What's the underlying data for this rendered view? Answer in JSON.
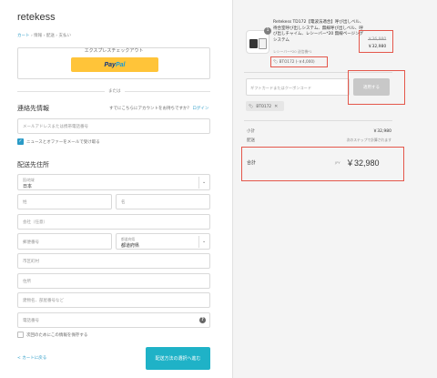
{
  "left": {
    "store_name": "retekess",
    "breadcrumbs": [
      "カート",
      "情報",
      "配送",
      "支払い"
    ],
    "express_title": "エクスプレスチェックアウト",
    "paypal_pay": "Pay",
    "paypal_pal": "Pal",
    "or_text": "または",
    "contact": {
      "heading": "連絡先情報",
      "has_account": "すでにこちらにアカウントをお持ちですか？",
      "login": "ログイン",
      "email_placeholder": "メールアドレスまたは携帯電話番号",
      "newsletter": "ニュースとオファーをメールで受け取る"
    },
    "shipping": {
      "heading": "配送先住所",
      "country_label": "国/地域",
      "country_value": "日本",
      "last_name": "姓",
      "first_name": "名",
      "company": "会社（任意）",
      "postal": "郵便番号",
      "pref_label": "都道府県",
      "pref_value": "都道府県",
      "city": "市区町村",
      "address": "住所",
      "building": "建物名、部屋番号など",
      "phone": "電話番号",
      "save_info": "次回のためにこの情報を保存する"
    },
    "back_link": "< カートに戻る",
    "continue_button": "配送方法の選択へ進む"
  },
  "right": {
    "product": {
      "quantity": "1",
      "name": "Retekess TD172【電波法適合】呼び出しベル、待合室呼び出しシステム、無線呼び出しベル、呼び出しチャイム、レシーバー*20 無線ページングシステム",
      "variant": "レシーバー*20 送信機*1",
      "discount": "BTO172 (-￥4,000)",
      "old_price": "￥36,980",
      "new_price": "￥32,980"
    },
    "gift_placeholder": "ギフトカードまたはクーポンコード",
    "apply_button": "適用する",
    "applied_code": "BTO172",
    "subtotal_label": "小計",
    "subtotal_value": "￥32,980",
    "shipping_label": "配送",
    "shipping_value": "次のステップで計算されます",
    "total_label": "合計",
    "total_currency": "JPY",
    "total_value": "￥32,980"
  }
}
